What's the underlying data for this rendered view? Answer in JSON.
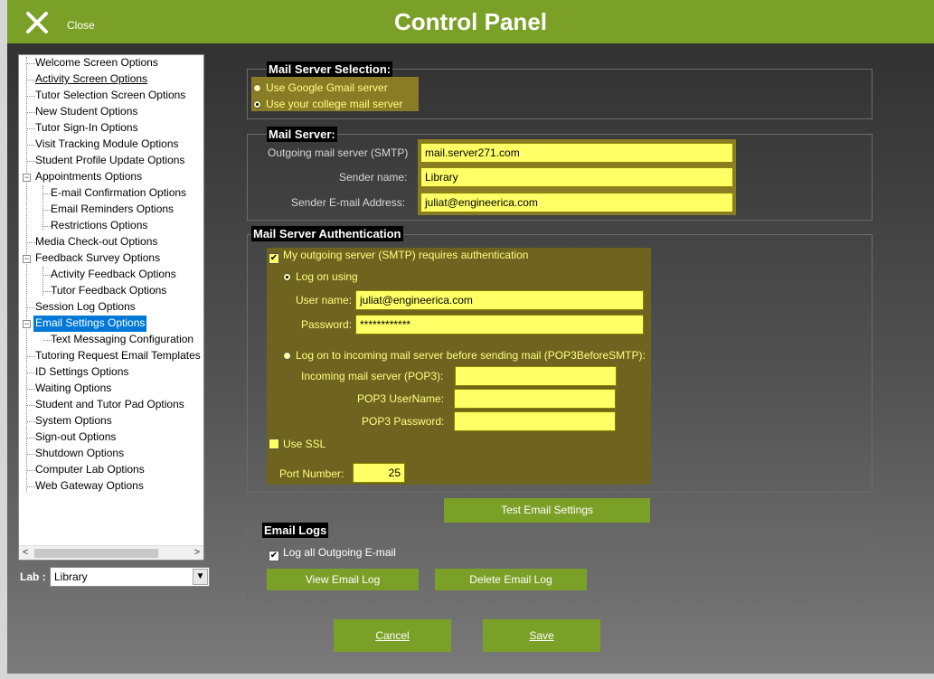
{
  "window": {
    "title": "Control Panel",
    "close_label": "Close"
  },
  "tree": {
    "items": [
      {
        "label": "Welcome Screen Options"
      },
      {
        "label": "Activity Screen Options"
      },
      {
        "label": "Tutor Selection Screen Options"
      },
      {
        "label": "New Student Options"
      },
      {
        "label": "Tutor Sign-In Options"
      },
      {
        "label": "Visit Tracking Module Options"
      },
      {
        "label": "Student Profile Update Options"
      },
      {
        "label": "Appointments Options"
      },
      {
        "label": "E-mail Confirmation Options"
      },
      {
        "label": "Email Reminders Options"
      },
      {
        "label": "Restrictions Options"
      },
      {
        "label": "Media Check-out Options"
      },
      {
        "label": "Feedback Survey Options"
      },
      {
        "label": "Activity Feedback Options"
      },
      {
        "label": "Tutor Feedback Options"
      },
      {
        "label": "Session Log Options"
      },
      {
        "label": "Email Settings Options"
      },
      {
        "label": "Text Messaging Configuration"
      },
      {
        "label": "Tutoring Request Email Templates"
      },
      {
        "label": "ID Settings Options"
      },
      {
        "label": "Waiting Options"
      },
      {
        "label": "Student and Tutor Pad Options"
      },
      {
        "label": "System Options"
      },
      {
        "label": "Sign-out Options"
      },
      {
        "label": "Shutdown Options"
      },
      {
        "label": "Computer Lab Options"
      },
      {
        "label": "Web Gateway Options"
      }
    ]
  },
  "lab": {
    "label": "Lab :",
    "value": "Library"
  },
  "mail_server_selection": {
    "title": "Mail Server Selection:",
    "option_gmail": "Use Google Gmail server",
    "option_college": "Use your college mail server",
    "selected": "college"
  },
  "mail_server": {
    "title": "Mail Server:",
    "smtp_label": "Outgoing mail server (SMTP)",
    "smtp_value": "mail.server271.com",
    "sender_name_label": "Sender name:",
    "sender_name_value": "Library",
    "sender_email_label": "Sender E-mail Address:",
    "sender_email_value": "juliat@engineerica.com"
  },
  "auth": {
    "title": "Mail Server Authentication",
    "requires_auth_label": "My outgoing server (SMTP) requires authentication",
    "requires_auth_checked": true,
    "logon_using_label": "Log on using",
    "username_label": "User name:",
    "username_value": "juliat@engineerica.com",
    "password_label": "Password:",
    "password_value": "************",
    "pop3_before_smtp_label": "Log on to incoming mail server before sending mail (POP3BeforeSMTP):",
    "pop3_server_label": "Incoming mail server (POP3):",
    "pop3_server_value": "",
    "pop3_user_label": "POP3 UserName:",
    "pop3_user_value": "",
    "pop3_password_label": "POP3 Password:",
    "pop3_password_value": "",
    "use_ssl_label": "Use SSL",
    "use_ssl_checked": false,
    "port_label": "Port Number:",
    "port_value": "25"
  },
  "test_button": "Test Email Settings",
  "email_logs": {
    "title": "Email Logs",
    "log_all_label": "Log all Outgoing E-mail",
    "log_all_checked": true,
    "view_button": "View Email Log",
    "delete_button": "Delete Email Log"
  },
  "footer": {
    "cancel_label": "Cancel",
    "save_label": "Save"
  },
  "colors": {
    "accent": "#7ba027",
    "field_bg": "#ffff66",
    "panel_olive": "#6e6420",
    "selection": "#0078d7"
  }
}
